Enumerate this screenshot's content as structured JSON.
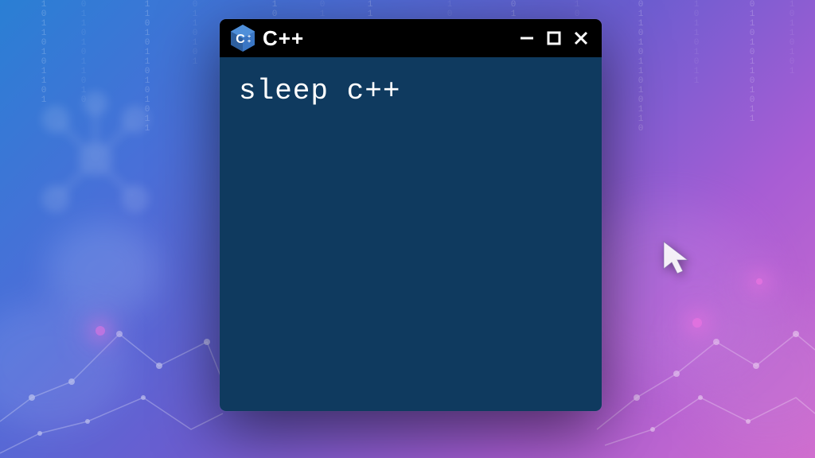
{
  "window": {
    "title": "C++",
    "icon_name": "cpp-logo",
    "content_text": "sleep c++"
  },
  "colors": {
    "titlebar_bg": "#000000",
    "content_bg": "#0f3a5f",
    "text": "#ffffff"
  }
}
